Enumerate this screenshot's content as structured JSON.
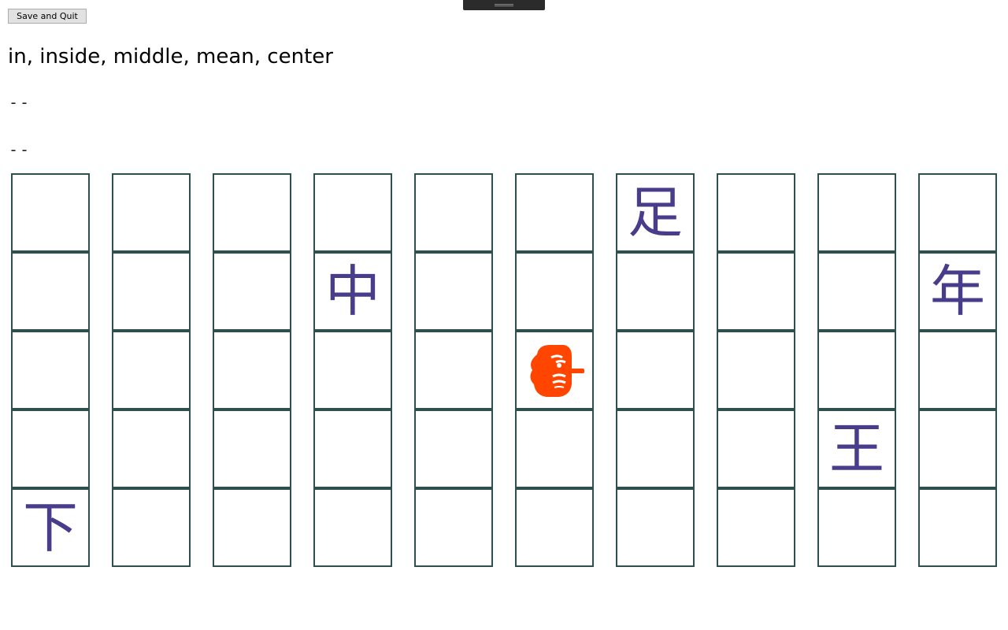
{
  "toolbar": {
    "save_quit_label": "Save and Quit"
  },
  "prompt": {
    "meaning": "in, inside, middle, mean, center",
    "reading_on": "--",
    "reading_kun": "--"
  },
  "board": {
    "columns": 10,
    "rows": 5,
    "tiles": [
      {
        "row": 0,
        "col": 6,
        "char": "足"
      },
      {
        "row": 1,
        "col": 3,
        "char": "中"
      },
      {
        "row": 1,
        "col": 9,
        "char": "年"
      },
      {
        "row": 3,
        "col": 8,
        "char": "王"
      },
      {
        "row": 4,
        "col": 0,
        "char": "下"
      }
    ],
    "player": {
      "row": 2,
      "col": 5,
      "icon": "tengu-icon"
    }
  },
  "colors": {
    "kanji": "#483d8b",
    "cell_border": "#2f4f4f",
    "player": "#ff4500"
  }
}
